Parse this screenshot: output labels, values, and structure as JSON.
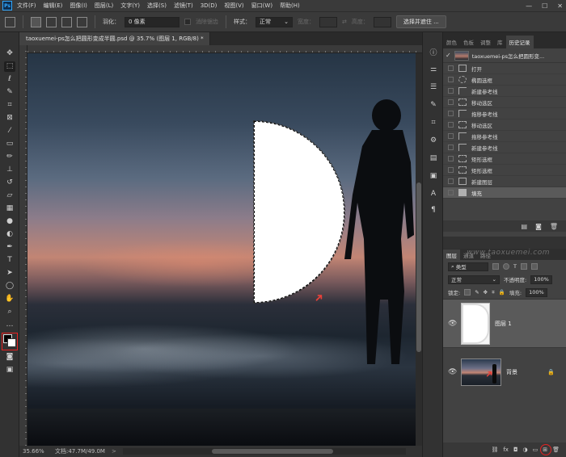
{
  "menu": {
    "logo": "Ps",
    "items": [
      "文件(F)",
      "编辑(E)",
      "图像(I)",
      "图层(L)",
      "文字(Y)",
      "选择(S)",
      "滤镜(T)",
      "3D(D)",
      "视图(V)",
      "窗口(W)",
      "帮助(H)"
    ],
    "minimize": "—",
    "maximize": "☐",
    "close": "✕"
  },
  "options": {
    "feather_label": "羽化：",
    "feather_value": "0 像素",
    "antialias_label": "消除锯齿",
    "style_label": "样式：",
    "style_value": "正常",
    "width_label": "宽度：",
    "height_label": "高度：",
    "select_mask_button": "选择并遮住 ..."
  },
  "document": {
    "tab_title": "taoxuemei-ps怎么把圆形变成半圆.psd @ 35.7% (图层 1, RGB/8) *",
    "close": "×"
  },
  "status": {
    "zoom": "35.66%",
    "doc_size": "文档:47.7M/49.0M",
    "arrow": ">"
  },
  "panels": {
    "top_tabs": [
      "颜色",
      "色板",
      "调整",
      "库",
      "历史记录"
    ],
    "active_top_tab": "历史记录",
    "history_source": "taoxuemei-ps怎么把圆形变...",
    "history": [
      {
        "label": "打开",
        "icon": "doc"
      },
      {
        "label": "椭圆选框",
        "icon": "ellipse"
      },
      {
        "label": "新建参考线",
        "icon": "guide"
      },
      {
        "label": "移动选区",
        "icon": "rect"
      },
      {
        "label": "拖移参考线",
        "icon": "guide"
      },
      {
        "label": "移动选区",
        "icon": "rect"
      },
      {
        "label": "拖移参考线",
        "icon": "guide"
      },
      {
        "label": "新建参考线",
        "icon": "guide"
      },
      {
        "label": "矩形选框",
        "icon": "rect"
      },
      {
        "label": "矩形选框",
        "icon": "rect"
      },
      {
        "label": "新建图层",
        "icon": "doc"
      },
      {
        "label": "填充",
        "icon": "fill"
      }
    ],
    "current_history": "填充",
    "layers_tabs": [
      "图层",
      "通道",
      "路径"
    ],
    "watermark": "www.taoxuemei.com",
    "kind_label": "类型",
    "blend_mode": "正常",
    "opacity_label": "不透明度:",
    "opacity_value": "100%",
    "lock_label": "锁定:",
    "fill_label": "填充:",
    "fill_value": "100%",
    "layers": [
      {
        "name": "图层 1",
        "selected": true
      },
      {
        "name": "背景",
        "selected": false
      }
    ],
    "footer_icons": [
      "link-icon",
      "fx-icon",
      "mask-icon",
      "adjustment-icon",
      "group-icon",
      "new-layer-icon",
      "trash-icon"
    ]
  },
  "colors": {
    "accent_red": "#e8413a",
    "selected_row": "#5a5a5a",
    "fill_shape": "#ffffff"
  }
}
